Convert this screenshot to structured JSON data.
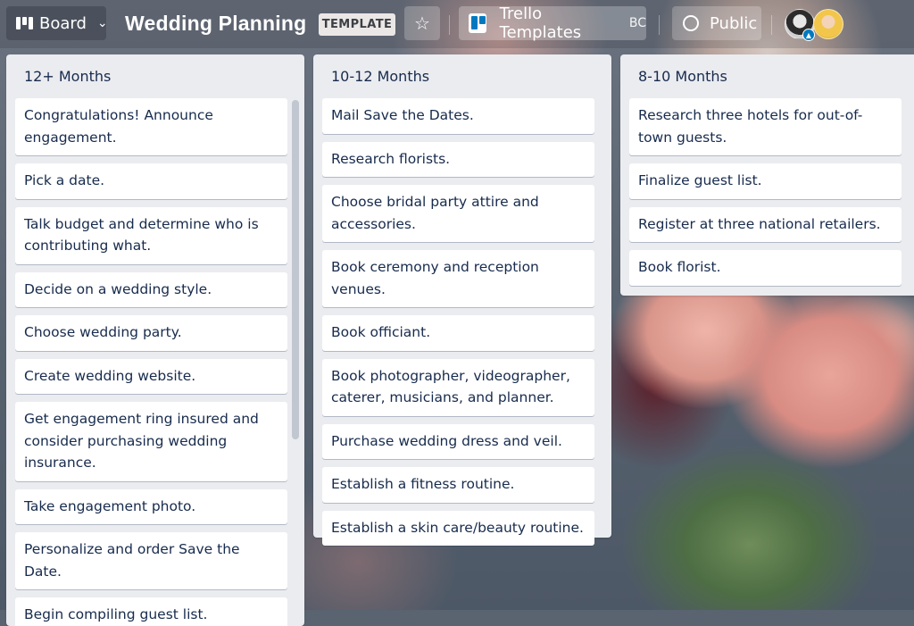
{
  "header": {
    "board_switcher_label": "Board",
    "board_title": "Wedding Planning",
    "template_badge": "TEMPLATE",
    "workspace_name": "Trello Templates",
    "workspace_tag": "BC",
    "visibility_label": "Public"
  },
  "lists": [
    {
      "title": "12+ Months",
      "cards": [
        "Congratulations! Announce engagement.",
        "Pick a date.",
        "Talk budget and determine who is contributing what.",
        "Decide on a wedding style.",
        "Choose wedding party.",
        "Create wedding website.",
        "Get engagement ring insured and consider purchasing wedding insurance.",
        "Take engagement photo.",
        "Personalize and order Save the Date.",
        "Begin compiling guest list."
      ]
    },
    {
      "title": "10-12 Months",
      "cards": [
        "Mail Save the Dates.",
        "Research florists.",
        "Choose bridal party attire and accessories.",
        "Book ceremony and reception venues.",
        "Book officiant.",
        "Book photographer, videographer, caterer, musicians, and planner.",
        "Purchase wedding dress and veil.",
        "Establish a fitness routine.",
        "Establish a skin care/beauty routine."
      ]
    },
    {
      "title": "8-10 Months",
      "cards": [
        "Research three hotels for out-of-town guests.",
        "Finalize guest list.",
        "Register at three national retailers.",
        "Book florist."
      ]
    }
  ],
  "colors": {
    "list_background": "#ebecf0",
    "card_text": "#172b4d",
    "trello_blue": "#0079bf"
  },
  "icons": {
    "board": "board-icon",
    "chevron": "chevron-down-icon",
    "star": "star-icon",
    "workspace": "trello-logo-icon",
    "visibility": "globe-icon"
  }
}
